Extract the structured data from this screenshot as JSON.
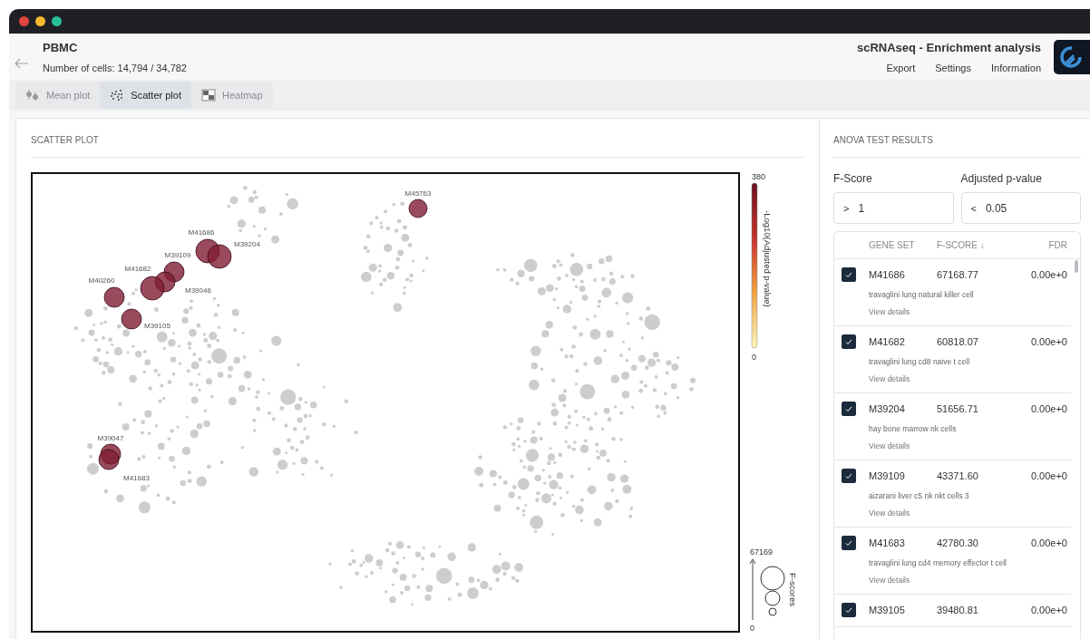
{
  "header": {
    "dataset": "PBMC",
    "cell_count": "Number of cells: 14,794 / 34,782",
    "app_title": "scRNAseq - Enrichment analysis",
    "menu": [
      "Export",
      "Settings",
      "Information"
    ]
  },
  "tabs": [
    {
      "label": "Mean plot",
      "kind": "mean",
      "selected": false
    },
    {
      "label": "Scatter plot",
      "kind": "scatter",
      "selected": true
    },
    {
      "label": "Heatmap",
      "kind": "heatmap",
      "selected": false
    }
  ],
  "plot_panel": {
    "title": "SCATTER PLOT",
    "point_labels": [
      "M45763",
      "M41686",
      "M39204",
      "M39109",
      "M39046",
      "M41682",
      "M40260",
      "M39105",
      "M39047",
      "M41683"
    ],
    "colorbar": {
      "max": "380",
      "min": "0",
      "label": "-Log10(Adjusted p-value)"
    },
    "size_legend": {
      "max": "67169",
      "min": "0",
      "label": "F-scores"
    }
  },
  "results": {
    "title": "ANOVA TEST RESULTS",
    "filters": [
      {
        "label": "F-Score",
        "operator": ">",
        "value": "1"
      },
      {
        "label": "Adjusted p-value",
        "operator": "<",
        "value": "0.05"
      }
    ],
    "columns": [
      "GENE SET",
      "F-SCORE ↓",
      "FDR"
    ],
    "rows": [
      {
        "checked": true,
        "gene_set": "M41686",
        "f_score": "67168.77",
        "fdr": "0.00e+0",
        "description": "travaglini lung natural killer cell",
        "link": "View details"
      },
      {
        "checked": true,
        "gene_set": "M41682",
        "f_score": "60818.07",
        "fdr": "0.00e+0",
        "description": "travaglini lung cd8 naive t cell",
        "link": "View details"
      },
      {
        "checked": true,
        "gene_set": "M39204",
        "f_score": "51656.71",
        "fdr": "0.00e+0",
        "description": "hay bone marrow nk cells",
        "link": "View details"
      },
      {
        "checked": true,
        "gene_set": "M39109",
        "f_score": "43371.60",
        "fdr": "0.00e+0",
        "description": "aizarani liver c5 nk nkt cells 3",
        "link": "View details"
      },
      {
        "checked": true,
        "gene_set": "M41683",
        "f_score": "42780.30",
        "fdr": "0.00e+0",
        "description": "travaglini lung cd4 memory effector t cell",
        "link": "View details"
      },
      {
        "checked": true,
        "gene_set": "M39105",
        "f_score": "39480.81",
        "fdr": "0.00e+0"
      }
    ]
  }
}
